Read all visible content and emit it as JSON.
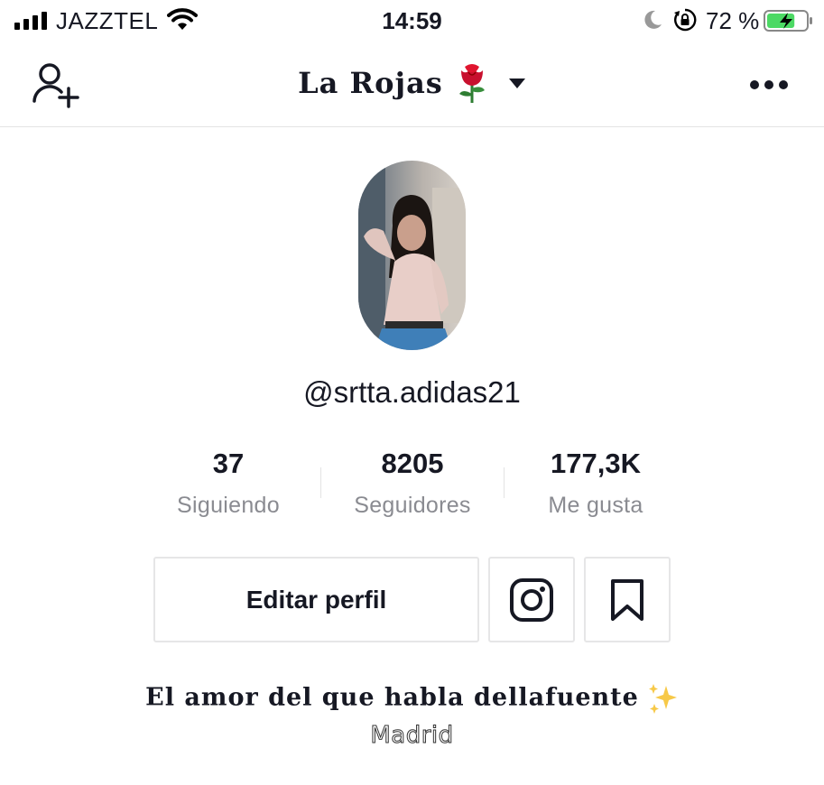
{
  "status_bar": {
    "carrier": "JAZZTEL",
    "time": "14:59",
    "battery_percent": "72 %",
    "battery_level": 0.72,
    "signal_bars": 4,
    "icons": [
      "signal-icon",
      "wifi-icon",
      "moon-icon",
      "rotation-lock-icon",
      "battery-charging-icon"
    ]
  },
  "header": {
    "title": "La Rojas",
    "title_emoji": "rose",
    "add_user_icon": "add-user-icon",
    "switch_icon": "caret-down-icon",
    "more_icon": "more-horizontal-icon"
  },
  "profile": {
    "username": "@srtta.adidas21",
    "stats": [
      {
        "value": "37",
        "label": "Siguiendo"
      },
      {
        "value": "8205",
        "label": "Seguidores"
      },
      {
        "value": "177,3K",
        "label": "Me gusta"
      }
    ],
    "edit_button_label": "Editar perfil",
    "instagram_icon": "instagram-icon",
    "bookmark_icon": "bookmark-icon",
    "bio": "El amor del que habla dellafuente",
    "bio_emoji": "sparkles",
    "location": "Madrid"
  },
  "colors": {
    "text_primary": "#161823",
    "text_secondary": "#8a8b91",
    "border": "#e3e3e4",
    "battery_green": "#4cd964",
    "rose_red": "#c8102e"
  }
}
